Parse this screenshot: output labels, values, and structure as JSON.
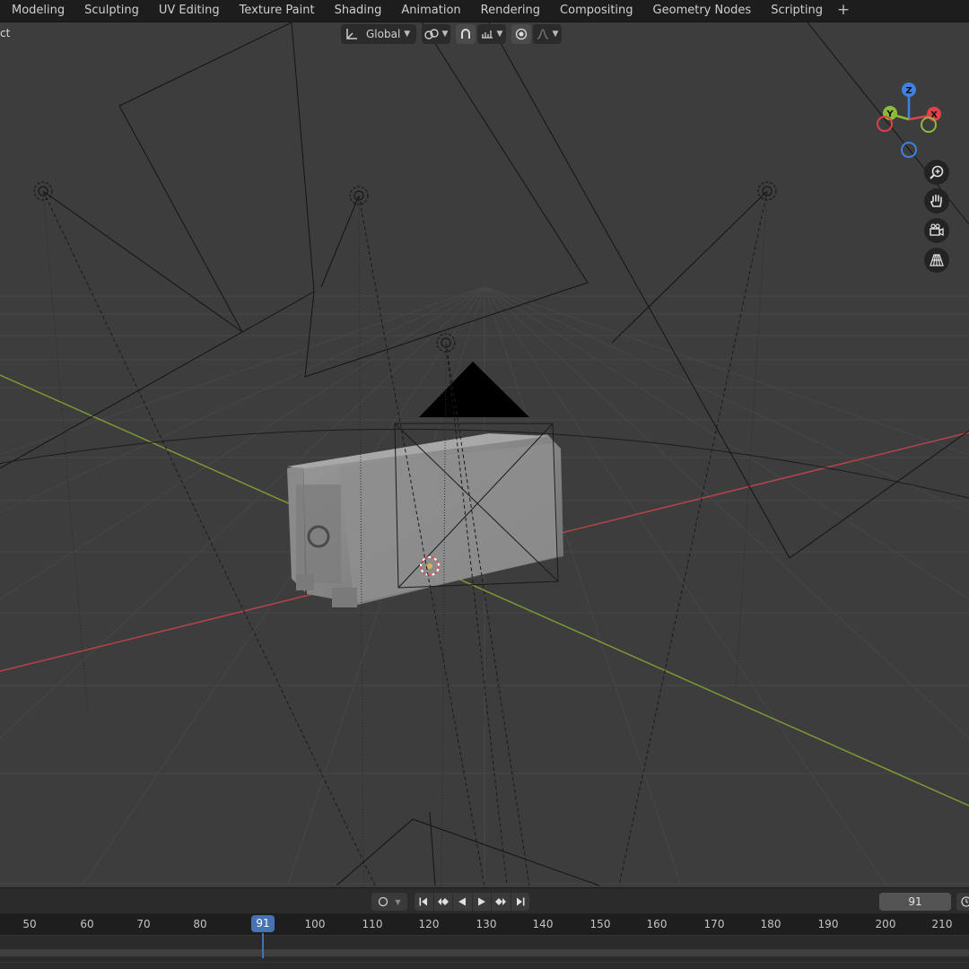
{
  "workspace_tabs": [
    "Modeling",
    "Sculpting",
    "UV Editing",
    "Texture Paint",
    "Shading",
    "Animation",
    "Rendering",
    "Compositing",
    "Geometry Nodes",
    "Scripting"
  ],
  "add_tab_label": "+",
  "viewport_header": {
    "mode_fragment": "ct",
    "orientation_label": "Global",
    "pivot_icon": "pivot-linked-icon",
    "snap_icon": "magnet-icon",
    "snap_target_icon": "snap-increment-icon",
    "proportional_icon": "proportional-editing-icon",
    "falloff_icon": "falloff-curve-icon"
  },
  "gizmo": {
    "z_label": "Z",
    "y_label": "Y",
    "x_label": "X",
    "colors": {
      "x": "#e0404a",
      "y": "#8cbb3c",
      "z": "#3d82e0"
    }
  },
  "nav_buttons": [
    "zoom-icon",
    "pan-hand-icon",
    "camera-view-icon",
    "perspective-grid-icon"
  ],
  "timeline": {
    "current_frame": "91",
    "playhead_label": "91",
    "ruler_labels": [
      "50",
      "60",
      "70",
      "80",
      "100",
      "110",
      "120",
      "130",
      "140",
      "150",
      "160",
      "170",
      "180",
      "190",
      "200",
      "210"
    ],
    "transport_icons": [
      "jump-start-icon",
      "prev-keyframe-icon",
      "play-reverse-icon",
      "play-icon",
      "next-keyframe-icon",
      "jump-end-icon"
    ]
  },
  "colors": {
    "x_axis": "#b5434b",
    "y_axis": "#7a9a32",
    "accent": "#4772b3",
    "grid": "#474747"
  }
}
